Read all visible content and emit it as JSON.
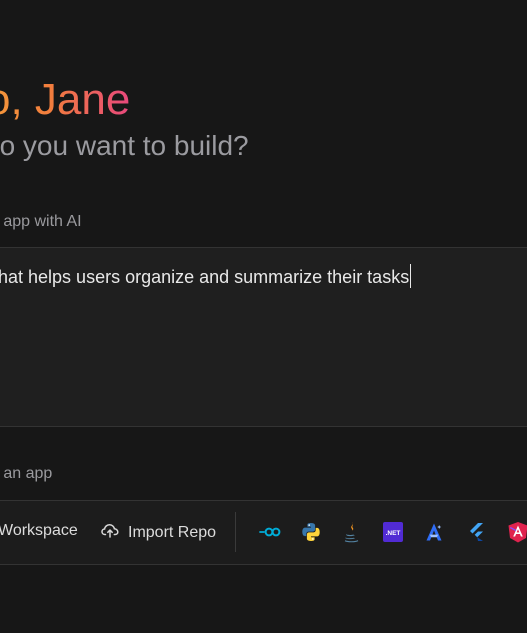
{
  "header": {
    "greeting": "o, Jane",
    "subtitle": "do you want to build?"
  },
  "prompt_section": {
    "label": "n app with AI",
    "prompt_text": "hat helps users organize and summarize their tasks"
  },
  "start_section": {
    "label": "g an app",
    "workspace_label": "Workspace",
    "import_repo_label": "Import Repo"
  },
  "frameworks": [
    {
      "icon": "go-icon",
      "color": "#00acd7"
    },
    {
      "icon": "python-icon",
      "color": "#3776ab"
    },
    {
      "icon": "java-icon",
      "color": "#f89820"
    },
    {
      "icon": "dotnet-icon",
      "color": "#512bd4"
    },
    {
      "icon": "angular-icon",
      "color": "#2f6df6"
    },
    {
      "icon": "flutter-icon",
      "color": "#42a5f5"
    },
    {
      "icon": "angular-red-icon",
      "color": "#e0234e"
    }
  ],
  "colors": {
    "background": "#171717",
    "greeting_gradient_start": "#f59a3a",
    "greeting_gradient_end": "#e8487d"
  }
}
